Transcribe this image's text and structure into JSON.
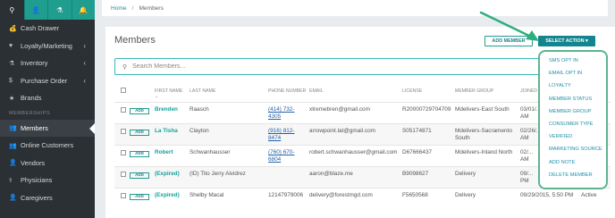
{
  "sidebar": {
    "top_tabs": [
      "⚲",
      "👤",
      "⚗",
      "🔔"
    ],
    "items": [
      {
        "label": "Cash Drawer",
        "icon": "💰",
        "chevron": false
      },
      {
        "label": "Loyalty/Marketing",
        "icon": "♥",
        "chevron": true
      },
      {
        "label": "Inventory",
        "icon": "⚗",
        "chevron": true
      },
      {
        "label": "Purchase Order",
        "icon": "$",
        "chevron": true
      },
      {
        "label": "Brands",
        "icon": "★",
        "chevron": false
      }
    ],
    "section": "MEMBERSHIPS",
    "items2": [
      {
        "label": "Members",
        "icon": "👥"
      },
      {
        "label": "Online Customers",
        "icon": "👥"
      },
      {
        "label": "Vendors",
        "icon": "👤"
      },
      {
        "label": "Physicians",
        "icon": "⚕"
      },
      {
        "label": "Caregivers",
        "icon": "👤"
      }
    ]
  },
  "breadcrumb": {
    "home": "Home",
    "sep": "/",
    "current": "Members"
  },
  "page": {
    "title": "Members",
    "add_member": "ADD MEMBER",
    "select_action": "SELECT ACTION ▾",
    "search_placeholder": "Search Members..."
  },
  "table": {
    "headers": {
      "first": "FIRST NAME",
      "first_sort": "⌄",
      "last": "LAST NAME",
      "phone": "PHONE NUMBER",
      "email": "EMAIL",
      "license": "LICENSE",
      "group": "MEMBER GROUP",
      "joined": "JOINED"
    },
    "add_label": "ADD",
    "rows": [
      {
        "first": "Brenden",
        "last": "Raasch",
        "phone": "(414) 732-4305",
        "email": "xtremebren@gmail.com",
        "license": "R20000729704709",
        "group": "Mdelivers-East South",
        "joined": "03/01/... AM",
        "status": ""
      },
      {
        "first": "La Tisha",
        "last": "Clayton",
        "phone": "(916) 812-8474",
        "email": "arrowpoint.lat@gmail.com",
        "license": "S05174871",
        "group": "Mdelivers-Sacramento South",
        "joined": "02/26/... AM",
        "status": ""
      },
      {
        "first": "Robert",
        "last": "Schwanhausser",
        "phone": "(760) 670-6804",
        "email": "robert.schwanhausser@gmail.com",
        "license": "D67666437",
        "group": "Mdelivers-Inland North",
        "joined": "02/... AM",
        "status": ""
      },
      {
        "first": "(Expired)",
        "last": "(ID) Tito Jerry Alvidrez",
        "phone": "",
        "email": "aaron@blaze.me",
        "license": "B9098627",
        "group": "Delivery",
        "joined": "09/... PM",
        "status": ""
      },
      {
        "first": "(Expired)",
        "last": "Shelby Macal",
        "phone": "12147979006",
        "email": "delivery@forestmgd.com",
        "license": "F5650568",
        "group": "Delivery",
        "joined": "09/29/2015, 5:50 PM",
        "status": "Active"
      }
    ]
  },
  "dropdown": [
    "SMS OPT IN",
    "EMAIL OPT IN",
    "LOYALTY",
    "MEMBER STATUS",
    "MEMBER GROUP",
    "CONSUMER TYPE",
    "VERIFIED",
    "MARKETING SOURCE",
    "ADD NOTE",
    "DELETE MEMBER"
  ],
  "colors": {
    "accent": "#13858f",
    "highlight": "#5cb58f",
    "sidebar": "#2b3034"
  }
}
